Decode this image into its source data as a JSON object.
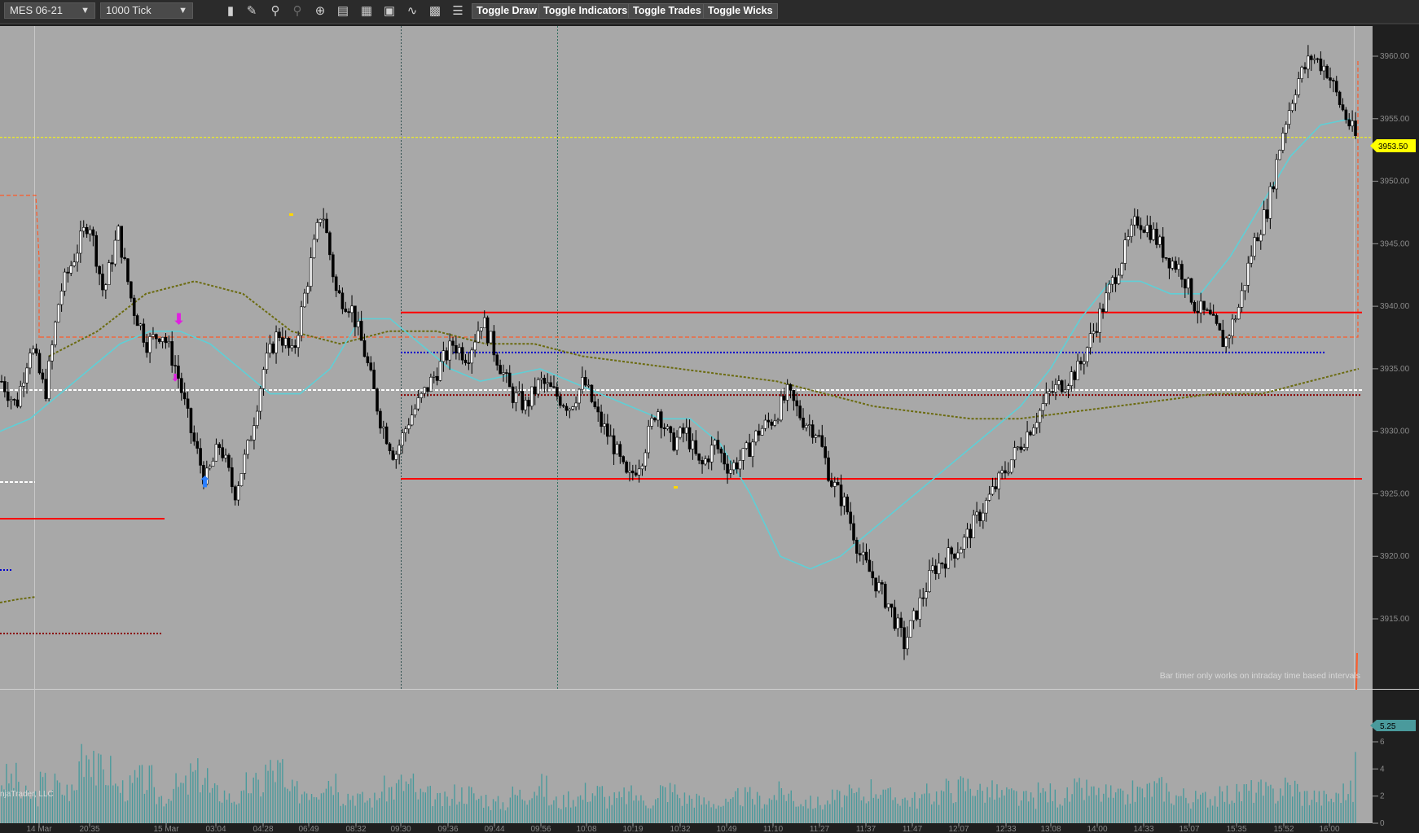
{
  "toolbar": {
    "instrument": "MES 06-21",
    "interval": "1000 Tick",
    "buttons": {
      "toggle_draw": "Toggle Draw",
      "toggle_indicators": "Toggle Indicators",
      "toggle_trades": "Toggle Trades",
      "toggle_wicks": "Toggle Wicks"
    },
    "icons": [
      "bar-type-icon",
      "pencil-draw-icon",
      "zoom-in-icon",
      "zoom-out-icon",
      "crosshair-icon",
      "properties-icon",
      "strategy-icon",
      "chart-trader-icon",
      "indicators-icon",
      "templates-icon",
      "data-series-list-icon"
    ]
  },
  "price_axis": {
    "ticks": [
      "3960.00",
      "3955.00",
      "3950.00",
      "3945.00",
      "3940.00",
      "3935.00",
      "3930.00",
      "3925.00",
      "3920.00",
      "3915.00"
    ],
    "last_price": "3953.50"
  },
  "volume_axis": {
    "ticks": [
      "6",
      "4",
      "2",
      "0"
    ],
    "last_value": "5.25"
  },
  "time_axis": {
    "labels": [
      "14 Mar",
      "20:35",
      "15 Mar",
      "03:04",
      "04:28",
      "06:49",
      "08:32",
      "09:30",
      "09:36",
      "09:44",
      "09:56",
      "10:08",
      "10:19",
      "10:32",
      "10:49",
      "11:10",
      "11:27",
      "11:37",
      "11:47",
      "12:07",
      "12:33",
      "13:08",
      "14:00",
      "14:33",
      "15:07",
      "15:35",
      "15:52",
      "16:00"
    ]
  },
  "messages": {
    "bar_timer": "Bar timer only works on intraday time based intervals",
    "copyright": "njaTrader, LLC"
  },
  "colors": {
    "chart_bg": "#a8a8a8",
    "axis_bg": "#1f1f1f",
    "ema_fast": "#5fcfd6",
    "ema_slow": "#6b6b10",
    "level_red": "#ff0000",
    "level_blue": "#0000cc",
    "last_price_line": "#ffff00",
    "volume": "#4a9a9c"
  },
  "chart_data": {
    "type": "line",
    "title": "",
    "xlabel": "",
    "ylabel": "",
    "ylim": [
      3912.5,
      3962.5
    ],
    "y_ticks": [
      3960,
      3955,
      3950,
      3945,
      3940,
      3935,
      3930,
      3925,
      3920,
      3915
    ],
    "x_labels": [
      "14 Mar",
      "20:35",
      "15 Mar",
      "03:04",
      "04:28",
      "06:49",
      "08:32",
      "09:30",
      "09:36",
      "09:44",
      "09:56",
      "10:08",
      "10:19",
      "10:32",
      "10:49",
      "11:10",
      "11:27",
      "11:37",
      "11:47",
      "12:07",
      "12:33",
      "13:08",
      "14:00",
      "14:33",
      "15:07",
      "15:35",
      "15:52",
      "16:00"
    ],
    "price_path": [
      3934,
      3932,
      3937,
      3933,
      3941,
      3944,
      3947,
      3941,
      3946,
      3940,
      3937,
      3938,
      3935,
      3930,
      3926,
      3929,
      3925,
      3929,
      3935,
      3938,
      3936,
      3942,
      3948,
      3941,
      3940,
      3936,
      3931,
      3928,
      3931,
      3933,
      3935,
      3937,
      3936,
      3939,
      3936,
      3933,
      3932,
      3934,
      3933,
      3932,
      3934,
      3931,
      3929,
      3926,
      3928,
      3932,
      3929,
      3930,
      3927,
      3929,
      3927,
      3928,
      3930,
      3931,
      3933,
      3931,
      3930,
      3926,
      3924,
      3920,
      3918,
      3916,
      3913,
      3916,
      3919,
      3920,
      3921,
      3923,
      3925,
      3927,
      3929,
      3931,
      3933,
      3934,
      3935,
      3938,
      3941,
      3944,
      3947,
      3946,
      3944,
      3943,
      3940,
      3939,
      3937,
      3940,
      3945,
      3948,
      3954,
      3958,
      3960,
      3959,
      3956,
      3953.5
    ],
    "ema_fast": [
      3930,
      3931,
      3933,
      3935,
      3937,
      3938,
      3938,
      3937,
      3935,
      3933,
      3933,
      3935,
      3939,
      3939,
      3937,
      3935,
      3934,
      3934.5,
      3935,
      3934,
      3933,
      3932,
      3931,
      3931,
      3929,
      3925,
      3920,
      3919,
      3920,
      3922,
      3924,
      3926,
      3928,
      3930,
      3932,
      3935,
      3939,
      3942,
      3942,
      3941,
      3941,
      3944,
      3948,
      3952,
      3954.5,
      3955
    ],
    "ema_slow": [
      3936,
      3938,
      3941,
      3942,
      3941,
      3938,
      3937,
      3938,
      3938,
      3937,
      3937,
      3936,
      3935.5,
      3935,
      3934.5,
      3934,
      3933,
      3932,
      3931.5,
      3931,
      3931,
      3931.5,
      3932,
      3932.5,
      3933,
      3933,
      3934,
      3935
    ],
    "levels": [
      {
        "price": 3939.5,
        "color": "red",
        "style": "solid"
      },
      {
        "price": 3926.2,
        "color": "red",
        "style": "solid"
      },
      {
        "price": 3936.3,
        "color": "blue",
        "style": "dotted"
      },
      {
        "price": 3933.3,
        "color": "white",
        "style": "dashed"
      },
      {
        "price": 3932.9,
        "color": "darkred",
        "style": "dotted"
      },
      {
        "price": 3953.5,
        "color": "yellow",
        "style": "dashed"
      }
    ],
    "volume": [
      3.5,
      2.2,
      3.1,
      2.6,
      6,
      4.1,
      2.8,
      3.4,
      2.1,
      2.9,
      3.8,
      2.4,
      2.0,
      3.0,
      4.2,
      2.5,
      2.8,
      3.6,
      2.3,
      1.9,
      2.7,
      3.1,
      2.2,
      1.8,
      2.4,
      2.0,
      1.6,
      2.3,
      2.9,
      1.7,
      2.1,
      2.5,
      1.9,
      2.2,
      1.8,
      2.6,
      2.0,
      1.7,
      1.5,
      2.1,
      1.9,
      2.4,
      1.8,
      1.6,
      2.0,
      2.2,
      2.8,
      2.1,
      1.9,
      2.3,
      2.7,
      3.0,
      2.5,
      2.2,
      1.9,
      2.4,
      2.1,
      2.6,
      2.3,
      2.0,
      2.5,
      2.8,
      2.2,
      1.9,
      2.1,
      2.3,
      2.6,
      2.4,
      2.9,
      2.2,
      2.0,
      2.5,
      5.25
    ]
  }
}
